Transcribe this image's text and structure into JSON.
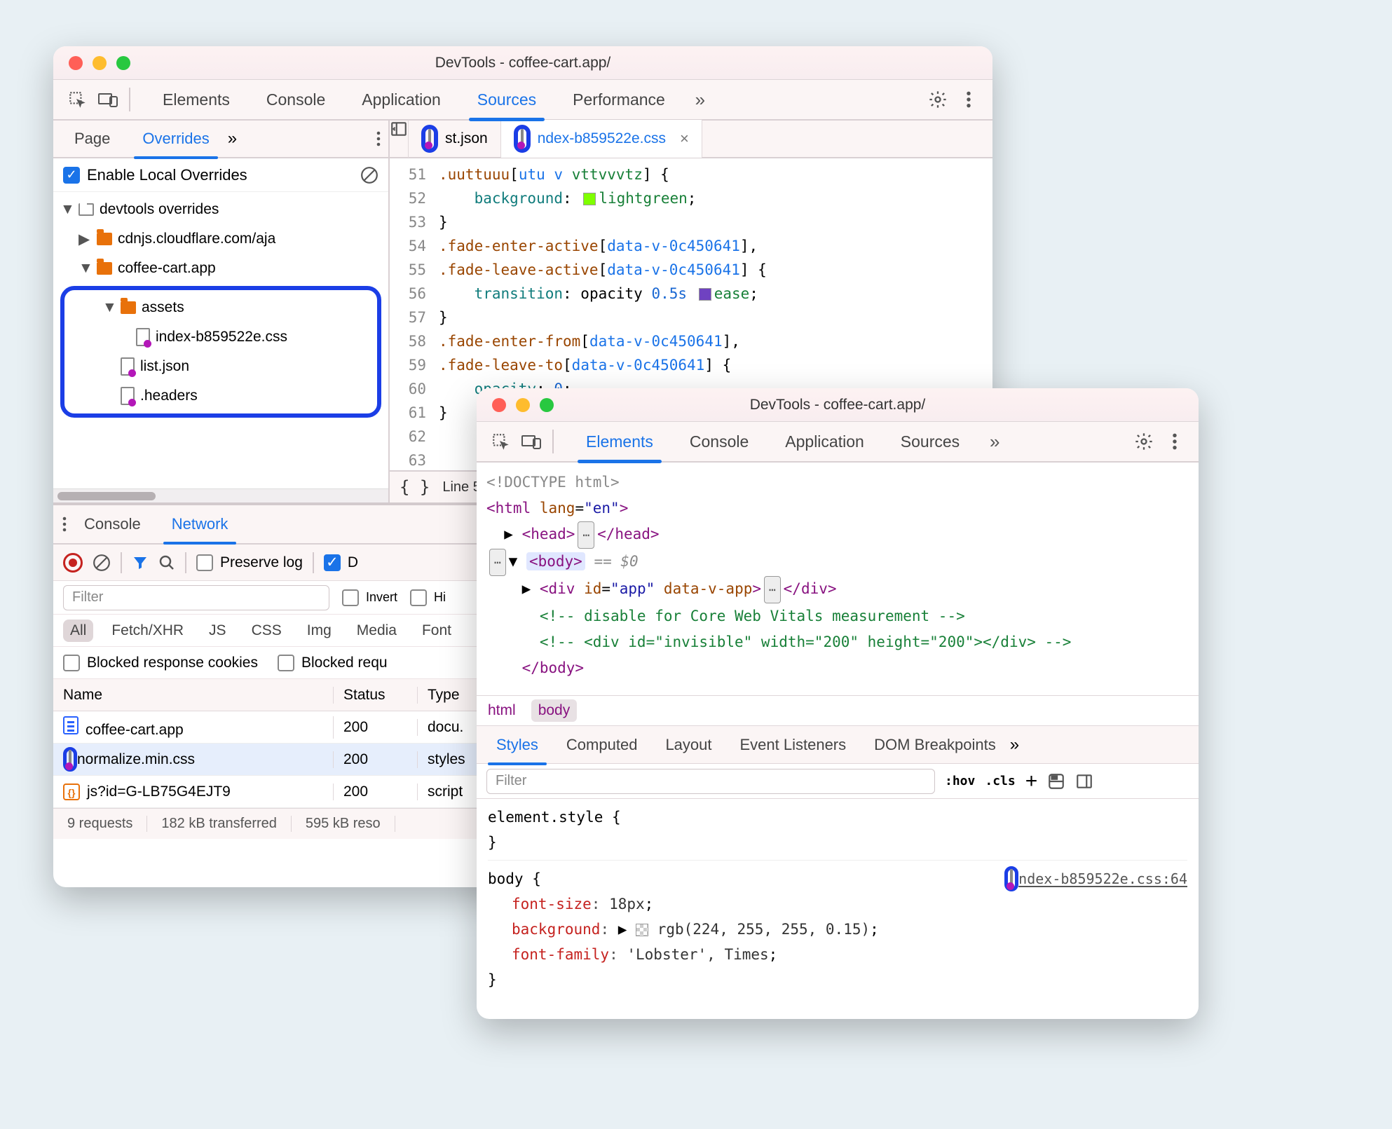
{
  "window1": {
    "title": "DevTools - coffee-cart.app/",
    "tabs": [
      "Elements",
      "Console",
      "Application",
      "Sources",
      "Performance"
    ],
    "active_tab": "Sources",
    "subtabs": [
      "Page",
      "Overrides"
    ],
    "active_subtab": "Overrides",
    "enable_overrides": "Enable Local Overrides",
    "tree": {
      "root": "devtools overrides",
      "cdnjs": "cdnjs.cloudflare.com/aja",
      "app": "coffee-cart.app",
      "assets": "assets",
      "css": "index-b859522e.css",
      "json": "list.json",
      "headers": ".headers"
    },
    "file_tabs": {
      "a": "st.json",
      "b": "ndex-b859522e.css"
    },
    "code_lines": [
      ".uuttuuu    {utu v vttvvvtz} {",
      "    background:  lightgreen;",
      "}",
      ".fade-enter-active[data-v-0c450641],",
      ".fade-leave-active[data-v-0c450641] {",
      "    transition: opacity 0.5s  ease;",
      "}",
      ".fade-enter-from[data-v-0c450641],",
      ".fade-leave-to[data-v-0c450641] {",
      "    opacity: 0;",
      "}",
      "",
      ""
    ],
    "line_start": 51,
    "status": {
      "line": "Line 58"
    },
    "drawer": {
      "tabs": [
        "Console",
        "Network"
      ],
      "active": "Network",
      "preserve_log": "Preserve log",
      "d_label": "D",
      "filter_placeholder": "Filter",
      "invert": "Invert",
      "hide": "Hi",
      "types": [
        "All",
        "Fetch/XHR",
        "JS",
        "CSS",
        "Img",
        "Media",
        "Font"
      ],
      "blocked_cookies": "Blocked response cookies",
      "blocked_requests": "Blocked requ",
      "cols": [
        "Name",
        "Status",
        "Type"
      ],
      "rows": [
        {
          "name": "coffee-cart.app",
          "status": "200",
          "type": "docu.",
          "icon": "page"
        },
        {
          "name": "normalize.min.css",
          "status": "200",
          "type": "styles",
          "icon": "override"
        },
        {
          "name": "js?id=G-LB75G4EJT9",
          "status": "200",
          "type": "script",
          "icon": "js"
        }
      ],
      "summary": [
        "9 requests",
        "182 kB transferred",
        "595 kB reso"
      ]
    }
  },
  "window2": {
    "title": "DevTools - coffee-cart.app/",
    "tabs": [
      "Elements",
      "Console",
      "Application",
      "Sources"
    ],
    "active_tab": "Elements",
    "dom": {
      "doctype": "<!DOCTYPE html>",
      "html_open": "<html lang=\"en\">",
      "head": "<head> … </head>",
      "body_open": "<body>",
      "body_anno": "== $0",
      "app_div": "<div id=\"app\" data-v-app> … </div>",
      "c1": "<!-- disable for Core Web Vitals measurement -->",
      "c2": "<!-- <div id=\"invisible\" width=\"200\" height=\"200\"></div> -->",
      "body_close": "</body>"
    },
    "crumbs": [
      "html",
      "body"
    ],
    "style_tabs": [
      "Styles",
      "Computed",
      "Layout",
      "Event Listeners",
      "DOM Breakpoints"
    ],
    "active_style_tab": "Styles",
    "styles_filter": "Filter",
    "hov": ":hov",
    "cls": ".cls",
    "src_label": "ndex-b859522e.css:64",
    "rules": {
      "el": "element.style {",
      "body": "body {",
      "fs": "font-size",
      "fs_v": "18px",
      "bg": "background",
      "bg_v": "rgb(224, 255, 255, 0.15)",
      "ff": "font-family",
      "ff_v": "'Lobster', Times"
    }
  }
}
